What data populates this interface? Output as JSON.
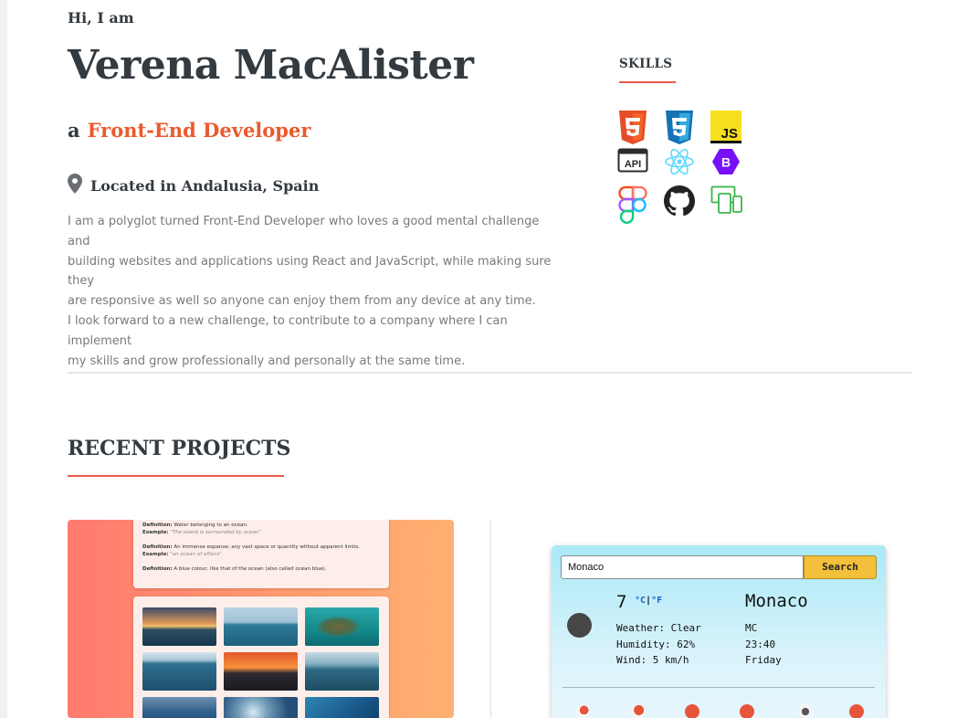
{
  "hero": {
    "greeting": "Hi, I am",
    "name": "Verena MacAlister",
    "role_prefix": "a",
    "role_title": "Front-End Developer",
    "location": "Located in Andalusia, Spain",
    "about_lines": [
      "I am a polyglot turned Front-End Developer who loves a good mental challenge and",
      "building websites and applications using React and JavaScript, while making sure they",
      "are responsive as well so anyone can enjoy them from any device at any time.",
      "I look forward to a new challenge, to contribute to a company where I can implement",
      "my skills and grow professionally and personally at the same time."
    ]
  },
  "skills": {
    "title": "SKILLS",
    "icons": [
      "html5-icon",
      "css3-icon",
      "javascript-icon",
      "api-icon",
      "react-icon",
      "bootstrap-icon",
      "figma-icon",
      "github-icon",
      "responsive-design-icon"
    ],
    "js_label": "JS",
    "api_label": "API",
    "bootstrap_label": "B"
  },
  "projects": {
    "title": "RECENT PROJECTS",
    "dictionary": {
      "definitions": [
        {
          "definition_label": "Definition:",
          "definition": "Water belonging to an ocean.",
          "example_label": "Example:",
          "example": "\"The island is surrounded by ocean\""
        },
        {
          "definition_label": "Definition:",
          "definition": "An immense expanse; any vast space or quantity without apparent limits.",
          "example_label": "Example:",
          "example": "\"an ocean of affairs\""
        },
        {
          "definition_label": "Definition:",
          "definition": "A blue colour, like that of the ocean (also called ocean blue).",
          "example_label": "",
          "example": ""
        }
      ]
    },
    "weather": {
      "search_value": "Monaco",
      "search_button": "Search",
      "temperature": "7",
      "unit_c": "°C",
      "unit_sep": "|",
      "unit_f": "°F",
      "details": [
        "Weather: Clear",
        "Humidity: 62%",
        "Wind: 5 km/h"
      ],
      "city": "Monaco",
      "info": [
        "MC",
        "23:40",
        "Friday"
      ]
    }
  },
  "colors": {
    "accent": "#ea5a2d",
    "underline": "#ea5a4a",
    "text": "#333a40",
    "muted": "#7a7a7a"
  }
}
